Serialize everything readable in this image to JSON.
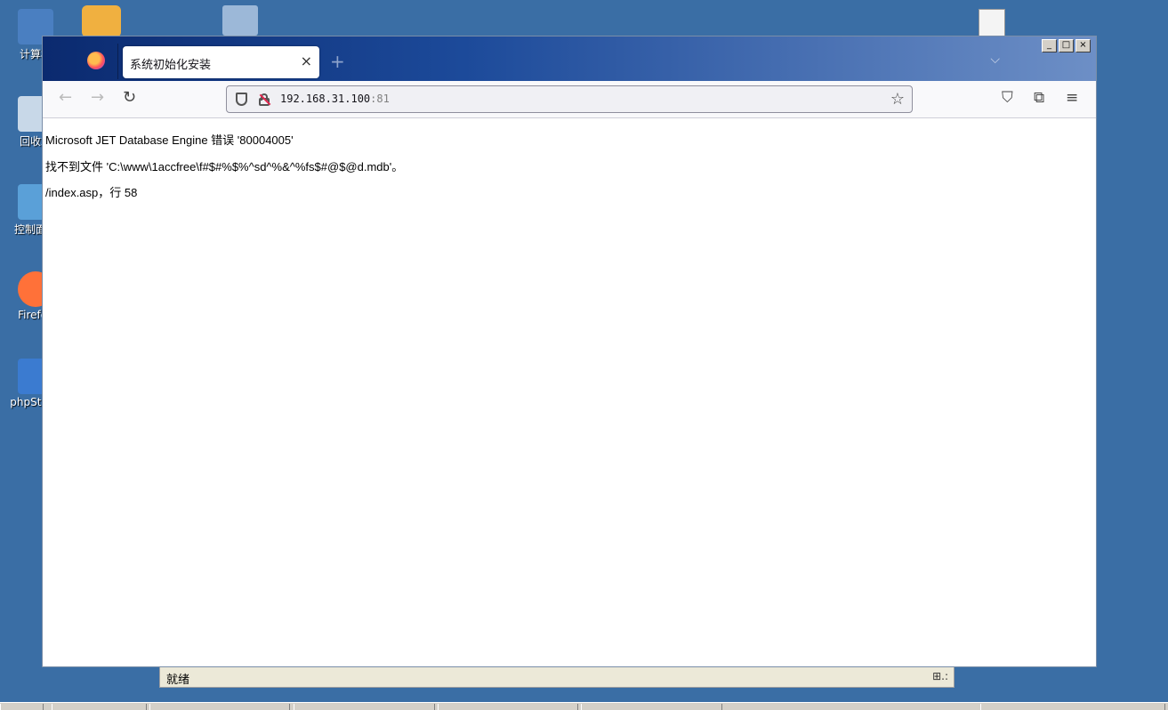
{
  "desktop": {
    "icons": [
      {
        "label": "计算机",
        "color": "#4a7fc1"
      },
      {
        "label": "回收站",
        "color": "#c8d8e8"
      },
      {
        "label": "控制面板",
        "color": "#5aa0d8"
      },
      {
        "label": "Firefox",
        "color": "#ff7139"
      },
      {
        "label": "phpStudy",
        "color": "#3b7bd0"
      }
    ]
  },
  "window": {
    "controls": [
      "_",
      "□",
      "×"
    ]
  },
  "browser": {
    "tab": {
      "title": "系统初始化安装",
      "close": "×"
    },
    "new_tab": "+",
    "tab_list": "⌵",
    "nav": {
      "back": "←",
      "forward": "→",
      "reload": "↻"
    },
    "url": {
      "host": "192.168.31.100",
      "port": ":81"
    },
    "bookmark_star": "☆",
    "toolbar": {
      "pocket": "⛉",
      "extensions": "⧉",
      "menu": "≡"
    }
  },
  "page": {
    "error_line": "Microsoft JET Database Engine 错误 '80004005'",
    "detail_line": "找不到文件 'C:\\www\\1accfree\\f#$#%$%^sd^%&^%fs$#@$@d.mdb'。",
    "location_line": "/index.asp，行 58"
  },
  "statusbar": {
    "text": "就绪",
    "zone_icon": "⊞.:"
  }
}
